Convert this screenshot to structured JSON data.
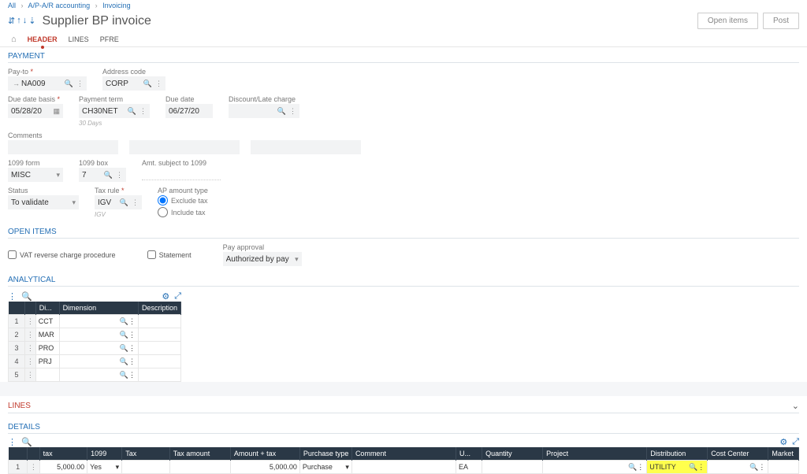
{
  "breadcrumb": {
    "all": "All",
    "one": "A/P-A/R accounting",
    "two": "Invoicing"
  },
  "title": "Supplier BP invoice",
  "buttons": {
    "open_items": "Open items",
    "post": "Post"
  },
  "tabs": {
    "header": "HEADER",
    "lines": "LINES",
    "pfre": "PFRE"
  },
  "payment": {
    "header": "PAYMENT",
    "pay_to_label": "Pay-to",
    "pay_to": "NA009",
    "address_label": "Address code",
    "address": "CORP",
    "due_basis_label": "Due date basis",
    "due_basis": "05/28/20",
    "payment_term_label": "Payment term",
    "payment_term": "CH30NET",
    "payment_term_sub": "30 Days",
    "due_date_label": "Due date",
    "due_date": "06/27/20",
    "late_label": "Discount/Late charge",
    "comments_label": "Comments",
    "f1099_label": "1099 form",
    "f1099": "MISC",
    "b1099_label": "1099 box",
    "b1099": "7",
    "amt_label": "Amt. subject to 1099",
    "status_label": "Status",
    "status": "To validate",
    "tax_rule_label": "Tax rule",
    "tax_rule": "IGV",
    "tax_rule_sub": "IGV",
    "ap_type_label": "AP amount type",
    "ap_excl": "Exclude tax",
    "ap_incl": "Include tax"
  },
  "open": {
    "header": "OPEN ITEMS",
    "vat": "VAT reverse charge procedure",
    "stmt": "Statement",
    "pay_app_label": "Pay approval",
    "pay_app": "Authorized by pay"
  },
  "analytical": {
    "header": "ANALYTICAL",
    "cols": {
      "di": "Di...",
      "dim": "Dimension",
      "desc": "Description"
    },
    "rows": [
      {
        "n": "1",
        "di": "CCT"
      },
      {
        "n": "2",
        "di": "MAR"
      },
      {
        "n": "3",
        "di": "PRO"
      },
      {
        "n": "4",
        "di": "PRJ"
      },
      {
        "n": "5",
        "di": ""
      }
    ]
  },
  "lines": {
    "header": "LINES",
    "details": "DETAILS",
    "cols": {
      "tax": "tax",
      "f1099": "1099",
      "taxcol": "Tax",
      "taxamt": "Tax amount",
      "amtplus": "Amount + tax",
      "ptype": "Purchase type",
      "comment": "Comment",
      "u": "U...",
      "qty": "Quantity",
      "proj": "Project",
      "dist": "Distribution",
      "cc": "Cost Center",
      "mkt": "Market"
    },
    "row": {
      "n": "1",
      "tax": "5,000.00",
      "f1099": "Yes",
      "amtplus": "5,000.00",
      "ptype": "Purchase",
      "u": "EA",
      "dist": "UTILITY"
    }
  }
}
